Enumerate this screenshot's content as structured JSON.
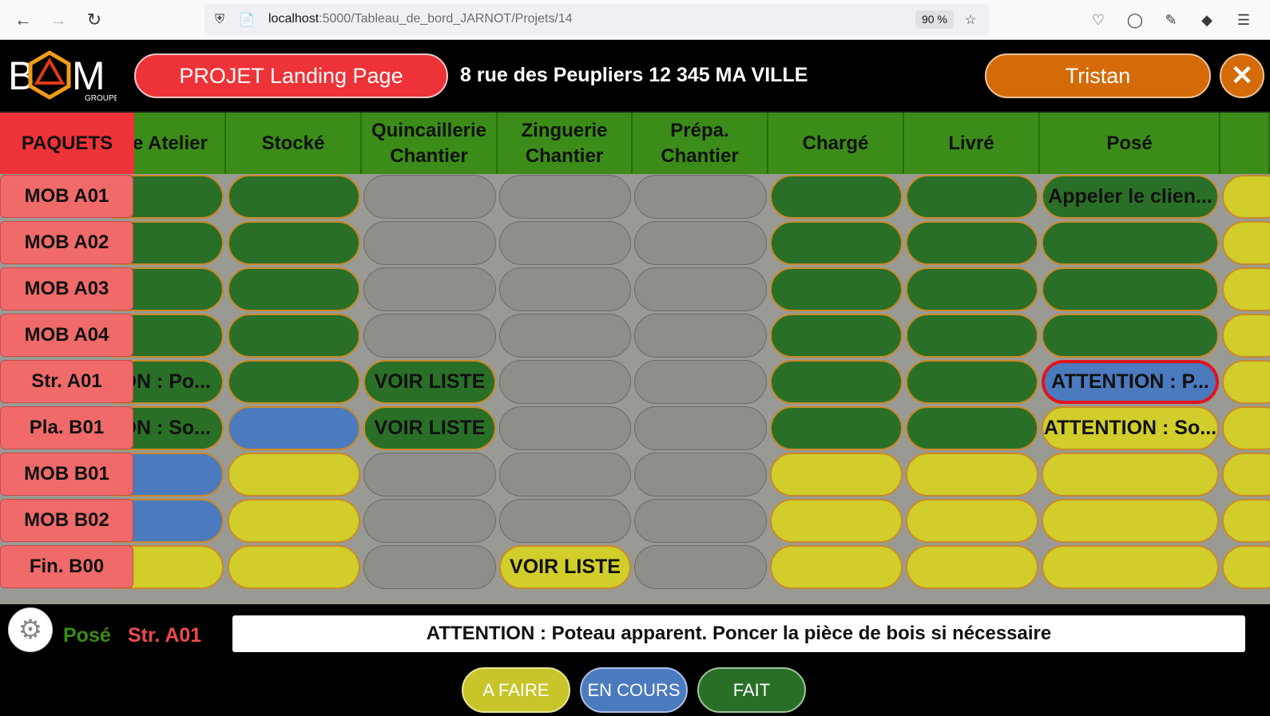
{
  "browser": {
    "url_host": "localhost",
    "url_path": ":5000/Tableau_de_bord_JARNOT/Projets/14",
    "zoom": "90 %"
  },
  "header": {
    "logo_text": "BAM",
    "logo_sub": "GROUPE",
    "project": "PROJET Landing Page",
    "address": "8 rue des Peupliers 12 345 MA VILLE",
    "user": "Tristan",
    "close": "✕"
  },
  "grid": {
    "paquets_label": "PAQUETS",
    "columns": [
      "e Atelier",
      "Stocké",
      "Quincaillerie\nChantier",
      "Zinguerie\nChantier",
      "Prépa.\nChantier",
      "Chargé",
      "Livré",
      "Posé",
      ""
    ],
    "rows": [
      {
        "label": "MOB A01",
        "cells": [
          {
            "s": "green",
            "t": ""
          },
          {
            "s": "green",
            "t": ""
          },
          {
            "s": "gray",
            "t": ""
          },
          {
            "s": "gray",
            "t": ""
          },
          {
            "s": "gray",
            "t": ""
          },
          {
            "s": "green",
            "t": ""
          },
          {
            "s": "green",
            "t": ""
          },
          {
            "s": "green",
            "t": "Appeler le clien..."
          },
          {
            "s": "yellow",
            "t": ""
          }
        ]
      },
      {
        "label": "MOB A02",
        "cells": [
          {
            "s": "green",
            "t": ""
          },
          {
            "s": "green",
            "t": ""
          },
          {
            "s": "gray",
            "t": ""
          },
          {
            "s": "gray",
            "t": ""
          },
          {
            "s": "gray",
            "t": ""
          },
          {
            "s": "green",
            "t": ""
          },
          {
            "s": "green",
            "t": ""
          },
          {
            "s": "green",
            "t": ""
          },
          {
            "s": "yellow",
            "t": ""
          }
        ]
      },
      {
        "label": "MOB A03",
        "cells": [
          {
            "s": "green",
            "t": ""
          },
          {
            "s": "green",
            "t": ""
          },
          {
            "s": "gray",
            "t": ""
          },
          {
            "s": "gray",
            "t": ""
          },
          {
            "s": "gray",
            "t": ""
          },
          {
            "s": "green",
            "t": ""
          },
          {
            "s": "green",
            "t": ""
          },
          {
            "s": "green",
            "t": ""
          },
          {
            "s": "yellow",
            "t": ""
          }
        ]
      },
      {
        "label": "MOB A04",
        "cells": [
          {
            "s": "green",
            "t": ""
          },
          {
            "s": "green",
            "t": ""
          },
          {
            "s": "gray",
            "t": ""
          },
          {
            "s": "gray",
            "t": ""
          },
          {
            "s": "gray",
            "t": ""
          },
          {
            "s": "green",
            "t": ""
          },
          {
            "s": "green",
            "t": ""
          },
          {
            "s": "green",
            "t": ""
          },
          {
            "s": "yellow",
            "t": ""
          }
        ]
      },
      {
        "label": "Str. A01",
        "cells": [
          {
            "s": "green",
            "t": "ON : Po..."
          },
          {
            "s": "green",
            "t": ""
          },
          {
            "s": "green",
            "t": "VOIR LISTE"
          },
          {
            "s": "gray",
            "t": ""
          },
          {
            "s": "gray",
            "t": ""
          },
          {
            "s": "green",
            "t": ""
          },
          {
            "s": "green",
            "t": ""
          },
          {
            "s": "blue",
            "t": "ATTENTION : P...",
            "alert": true
          },
          {
            "s": "yellow",
            "t": ""
          }
        ]
      },
      {
        "label": "Pla. B01",
        "cells": [
          {
            "s": "green",
            "t": "ON : So..."
          },
          {
            "s": "blue",
            "t": ""
          },
          {
            "s": "green",
            "t": "VOIR LISTE"
          },
          {
            "s": "gray",
            "t": ""
          },
          {
            "s": "gray",
            "t": ""
          },
          {
            "s": "green",
            "t": ""
          },
          {
            "s": "green",
            "t": ""
          },
          {
            "s": "yellow",
            "t": "ATTENTION : So..."
          },
          {
            "s": "yellow",
            "t": ""
          }
        ]
      },
      {
        "label": "MOB B01",
        "cells": [
          {
            "s": "blue",
            "t": ""
          },
          {
            "s": "yellow",
            "t": ""
          },
          {
            "s": "gray",
            "t": ""
          },
          {
            "s": "gray",
            "t": ""
          },
          {
            "s": "gray",
            "t": ""
          },
          {
            "s": "yellow",
            "t": ""
          },
          {
            "s": "yellow",
            "t": ""
          },
          {
            "s": "yellow",
            "t": ""
          },
          {
            "s": "yellow",
            "t": ""
          }
        ]
      },
      {
        "label": "MOB B02",
        "cells": [
          {
            "s": "blue",
            "t": ""
          },
          {
            "s": "yellow",
            "t": ""
          },
          {
            "s": "gray",
            "t": ""
          },
          {
            "s": "gray",
            "t": ""
          },
          {
            "s": "gray",
            "t": ""
          },
          {
            "s": "yellow",
            "t": ""
          },
          {
            "s": "yellow",
            "t": ""
          },
          {
            "s": "yellow",
            "t": ""
          },
          {
            "s": "yellow",
            "t": ""
          }
        ]
      },
      {
        "label": "Fin. B00",
        "cells": [
          {
            "s": "yellow",
            "t": ""
          },
          {
            "s": "yellow",
            "t": ""
          },
          {
            "s": "gray",
            "t": ""
          },
          {
            "s": "yellow",
            "t": "VOIR LISTE"
          },
          {
            "s": "gray",
            "t": ""
          },
          {
            "s": "yellow",
            "t": ""
          },
          {
            "s": "yellow",
            "t": ""
          },
          {
            "s": "yellow",
            "t": ""
          },
          {
            "s": "yellow",
            "t": ""
          }
        ]
      }
    ]
  },
  "footer": {
    "status": "Posé",
    "pack": "Str. A01",
    "comment": "ATTENTION : Poteau apparent. Poncer la pièce de bois si nécessaire",
    "btn_afaire": "A FAIRE",
    "btn_encours": "EN COURS",
    "btn_fait": "FAIT"
  },
  "colors": {
    "green": "#2a6f27",
    "yellow": "#d1cd2b",
    "blue": "#4b7abf",
    "gray": "#8f8f8a",
    "red": "#ee3338",
    "orange": "#d46b08"
  }
}
